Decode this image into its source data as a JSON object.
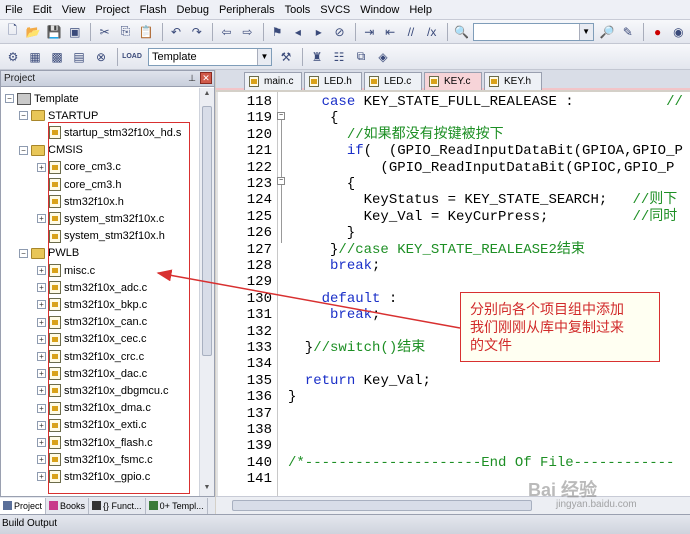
{
  "menu": [
    "File",
    "Edit",
    "View",
    "Project",
    "Flash",
    "Debug",
    "Peripherals",
    "Tools",
    "SVCS",
    "Window",
    "Help"
  ],
  "toolbar": {
    "target_value": "Template",
    "load_label": "LOAD"
  },
  "project_panel": {
    "title": "Project",
    "tree": [
      {
        "label": "Template",
        "kind": "root"
      },
      {
        "label": "STARTUP",
        "kind": "group"
      },
      {
        "label": "startup_stm32f10x_hd.s",
        "kind": "file"
      },
      {
        "label": "CMSIS",
        "kind": "group"
      },
      {
        "label": "core_cm3.c",
        "kind": "file"
      },
      {
        "label": "core_cm3.h",
        "kind": "file"
      },
      {
        "label": "stm32f10x.h",
        "kind": "file"
      },
      {
        "label": "system_stm32f10x.c",
        "kind": "file"
      },
      {
        "label": "system_stm32f10x.h",
        "kind": "file"
      },
      {
        "label": "PWLB",
        "kind": "group"
      },
      {
        "label": "misc.c",
        "kind": "file"
      },
      {
        "label": "stm32f10x_adc.c",
        "kind": "file"
      },
      {
        "label": "stm32f10x_bkp.c",
        "kind": "file"
      },
      {
        "label": "stm32f10x_can.c",
        "kind": "file"
      },
      {
        "label": "stm32f10x_cec.c",
        "kind": "file"
      },
      {
        "label": "stm32f10x_crc.c",
        "kind": "file"
      },
      {
        "label": "stm32f10x_dac.c",
        "kind": "file"
      },
      {
        "label": "stm32f10x_dbgmcu.c",
        "kind": "file"
      },
      {
        "label": "stm32f10x_dma.c",
        "kind": "file"
      },
      {
        "label": "stm32f10x_exti.c",
        "kind": "file"
      },
      {
        "label": "stm32f10x_flash.c",
        "kind": "file"
      },
      {
        "label": "stm32f10x_fsmc.c",
        "kind": "file"
      },
      {
        "label": "stm32f10x_gpio.c",
        "kind": "file"
      }
    ],
    "bottom_tabs": [
      "Project",
      "Books",
      "{} Funct...",
      "0+ Templ..."
    ]
  },
  "editor_tabs": [
    {
      "label": "main.c",
      "active": false
    },
    {
      "label": "LED.h",
      "active": false
    },
    {
      "label": "LED.c",
      "active": false
    },
    {
      "label": "KEY.c",
      "active": true
    },
    {
      "label": "KEY.h",
      "active": false
    }
  ],
  "code_lines": [
    {
      "n": "118",
      "parts": [
        [
          "pl",
          "    "
        ],
        [
          "kw",
          "case"
        ],
        [
          "pl",
          " KEY_STATE_FULL_REALEASE :"
        ],
        [
          "pl",
          "           "
        ],
        [
          "cm",
          "//"
        ]
      ]
    },
    {
      "n": "119",
      "parts": [
        [
          "pl",
          "     {"
        ]
      ]
    },
    {
      "n": "120",
      "parts": [
        [
          "pl",
          "       "
        ],
        [
          "cm",
          "//如果都没有按键被按下"
        ]
      ]
    },
    {
      "n": "121",
      "parts": [
        [
          "pl",
          "       "
        ],
        [
          "kw",
          "if"
        ],
        [
          "pl",
          "(  (GPIO_ReadInputDataBit(GPIOA,GPIO_P"
        ]
      ]
    },
    {
      "n": "122",
      "parts": [
        [
          "pl",
          "           (GPIO_ReadInputDataBit(GPIOC,GPIO_P"
        ]
      ]
    },
    {
      "n": "123",
      "parts": [
        [
          "pl",
          "       {"
        ]
      ]
    },
    {
      "n": "124",
      "parts": [
        [
          "pl",
          "         KeyStatus = KEY_STATE_SEARCH;   "
        ],
        [
          "cm",
          "//则下"
        ]
      ]
    },
    {
      "n": "125",
      "parts": [
        [
          "pl",
          "         Key_Val = KeyCurPress;          "
        ],
        [
          "cm",
          "//同时"
        ]
      ]
    },
    {
      "n": "126",
      "parts": [
        [
          "pl",
          "       }"
        ]
      ]
    },
    {
      "n": "127",
      "parts": [
        [
          "pl",
          "     }"
        ],
        [
          "cm",
          "//case "
        ],
        [
          "cm",
          "KEY_STATE_REALEASE2结束"
        ]
      ]
    },
    {
      "n": "128",
      "parts": [
        [
          "pl",
          "     "
        ],
        [
          "kw",
          "break"
        ],
        [
          "pl",
          ";"
        ]
      ]
    },
    {
      "n": "129",
      "parts": []
    },
    {
      "n": "130",
      "parts": [
        [
          "pl",
          "    "
        ],
        [
          "kw",
          "default"
        ],
        [
          "pl",
          " :"
        ]
      ]
    },
    {
      "n": "131",
      "parts": [
        [
          "pl",
          "     "
        ],
        [
          "kw",
          "break"
        ],
        [
          "pl",
          ";"
        ]
      ]
    },
    {
      "n": "132",
      "parts": []
    },
    {
      "n": "133",
      "parts": [
        [
          "pl",
          "  }"
        ],
        [
          "cm",
          "//switch()结束"
        ]
      ]
    },
    {
      "n": "134",
      "parts": []
    },
    {
      "n": "135",
      "parts": [
        [
          "pl",
          "  "
        ],
        [
          "kw",
          "return"
        ],
        [
          "pl",
          " Key_Val;"
        ]
      ]
    },
    {
      "n": "136",
      "parts": [
        [
          "pl",
          "}"
        ]
      ]
    },
    {
      "n": "137",
      "parts": []
    },
    {
      "n": "138",
      "parts": []
    },
    {
      "n": "139",
      "parts": []
    },
    {
      "n": "140",
      "parts": [
        [
          "cm",
          "/*---------------------End Of File------------"
        ]
      ]
    },
    {
      "n": "141",
      "parts": []
    }
  ],
  "annotation": {
    "lines": [
      "分别向各个项目组中添加",
      "我们刚刚从库中复制过来",
      "的文件"
    ]
  },
  "status_bar": {
    "text": "Build Output"
  },
  "watermark": {
    "text": "Bai 经验",
    "sub": "jingyan.baidu.com"
  },
  "colors": {
    "keyword": "#1a2fc8",
    "comment": "#1d8f24",
    "annotation": "#d12a2a",
    "active_tab": "#f7d4d8"
  }
}
